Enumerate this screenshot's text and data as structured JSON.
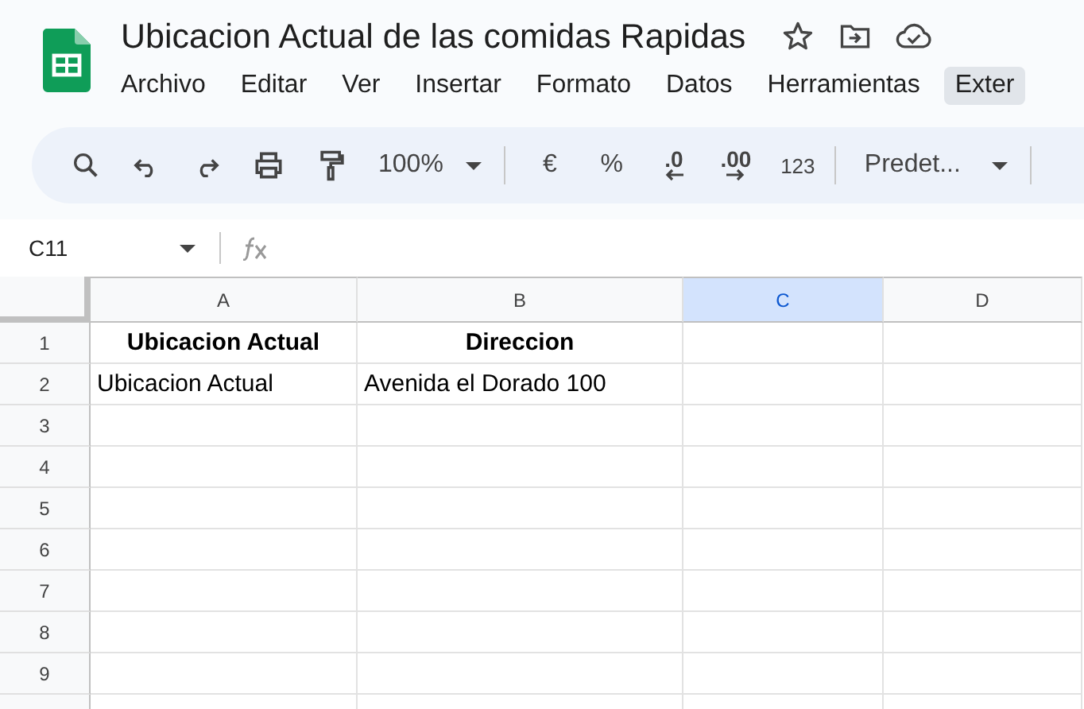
{
  "document": {
    "title": "Ubicacion Actual de las comidas Rapidas"
  },
  "menu": [
    {
      "label": "Archivo",
      "highlighted": false
    },
    {
      "label": "Editar",
      "highlighted": false
    },
    {
      "label": "Ver",
      "highlighted": false
    },
    {
      "label": "Insertar",
      "highlighted": false
    },
    {
      "label": "Formato",
      "highlighted": false
    },
    {
      "label": "Datos",
      "highlighted": false
    },
    {
      "label": "Herramientas",
      "highlighted": false
    },
    {
      "label": "Exter",
      "highlighted": true
    }
  ],
  "toolbar": {
    "zoom": "100%",
    "currency": "€",
    "percent": "%",
    "decrease_decimals": ".0",
    "increase_decimals": ".00",
    "number_format": "123",
    "font": "Predet..."
  },
  "formula_bar": {
    "cell_reference": "C11"
  },
  "sheet": {
    "columns": [
      {
        "label": "A",
        "selected": false
      },
      {
        "label": "B",
        "selected": false
      },
      {
        "label": "C",
        "selected": true
      },
      {
        "label": "D",
        "selected": false
      }
    ],
    "rows": [
      {
        "number": "1",
        "bold": true,
        "cells": [
          "Ubicacion Actual",
          "Direccion"
        ]
      },
      {
        "number": "2",
        "bold": false,
        "cells": [
          "Ubicacion Actual",
          "Avenida el Dorado 100"
        ]
      },
      {
        "number": "3"
      },
      {
        "number": "4"
      },
      {
        "number": "5"
      },
      {
        "number": "6"
      },
      {
        "number": "7"
      },
      {
        "number": "8"
      },
      {
        "number": "9"
      }
    ]
  }
}
